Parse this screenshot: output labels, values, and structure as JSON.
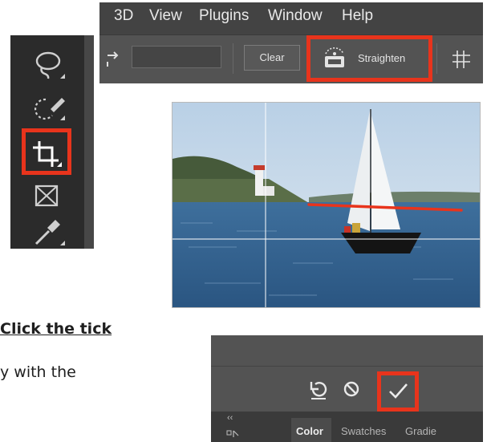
{
  "menubar": {
    "items": [
      "3D",
      "View",
      "Plugins",
      "Window",
      "Help"
    ]
  },
  "options_bar": {
    "clear_label": "Clear",
    "straighten_label": "Straighten"
  },
  "tools": [
    "lasso-tool",
    "quick-selection-tool",
    "crop-tool",
    "frame-tool",
    "eyedropper-tool"
  ],
  "caption": {
    "bold": "Click the tick",
    "body": "y with the"
  },
  "panel": {
    "collapse_glyph": "‹‹",
    "tabs": [
      "Color",
      "Swatches",
      "Gradie"
    ],
    "active_tab": "Color"
  },
  "colors": {
    "highlight": "#e8341c",
    "ui_dark": "#2b2b2b",
    "ui_mid": "#535353",
    "menu_bg": "#434343"
  }
}
